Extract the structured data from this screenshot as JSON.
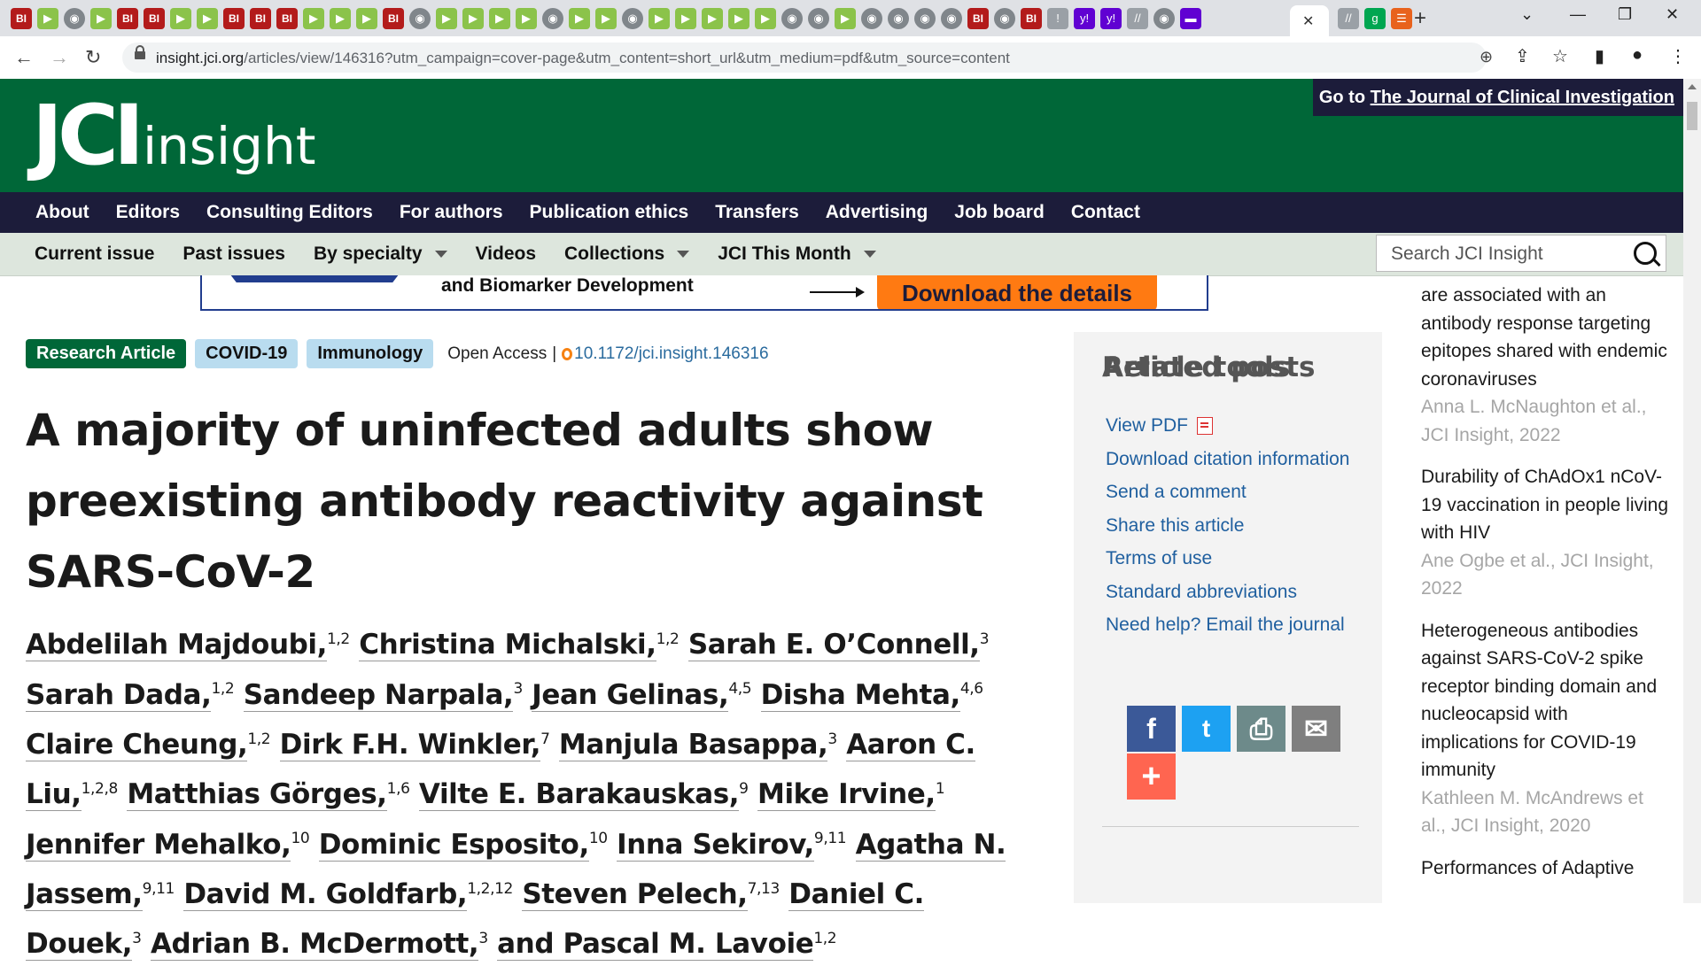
{
  "browser": {
    "url_host": "insight.jci.org",
    "url_rest": "/articles/view/146316?utm_campaign=cover-page&utm_content=short_url&utm_medium=pdf&utm_source=content",
    "tab_icons": [
      "BI",
      "▶",
      "◉",
      "▶",
      "BI",
      "BI",
      "▶",
      "▶",
      "BI",
      "BI",
      "BI",
      "▶",
      "▶",
      "▶",
      "BI",
      "◉",
      "▶",
      "▶",
      "▶",
      "▶",
      "◉",
      "▶",
      "▶",
      "◉",
      "▶",
      "▶",
      "▶",
      "▶",
      "▶",
      "◉",
      "◉",
      "▶",
      "◉",
      "◉",
      "◉",
      "◉",
      "BI",
      "◉",
      "BI",
      "!",
      "y!",
      "y!",
      "//",
      "◉",
      "▬"
    ],
    "active_tab_icons": [
      "//",
      "g",
      "☰"
    ],
    "close_tab": "✕",
    "new_tab": "+"
  },
  "header": {
    "logo_jci": "JCI",
    "logo_insight": "insight",
    "goto_prefix": "Go to",
    "goto_link": "The Journal of Clinical Investigation"
  },
  "main_nav": [
    "About",
    "Editors",
    "Consulting Editors",
    "For authors",
    "Publication ethics",
    "Transfers",
    "Advertising",
    "Job board",
    "Contact"
  ],
  "sub_nav": {
    "current_issue": "Current issue",
    "past_issues": "Past issues",
    "by_specialty": "By specialty",
    "videos": "Videos",
    "collections": "Collections",
    "jci_this_month": "JCI This Month",
    "search_placeholder": "Search JCI Insight"
  },
  "ad": {
    "text": "and Biomarker Development",
    "button": "Download the details"
  },
  "article": {
    "badges": [
      "Research Article",
      "COVID-19",
      "Immunology"
    ],
    "open_access": "Open Access",
    "separator": "|",
    "doi": "10.1172/jci.insight.146316",
    "title": "A majority of uninfected adults show preexisting antibody reactivity against SARS-CoV-2",
    "authors": [
      {
        "name": "Abdelilah Majdoubi,",
        "sup": "1,2"
      },
      {
        "name": "Christina Michalski,",
        "sup": "1,2"
      },
      {
        "name": "Sarah E. O’Connell,",
        "sup": "3"
      },
      {
        "name": "Sarah Dada,",
        "sup": "1,2"
      },
      {
        "name": "Sandeep Narpala,",
        "sup": "3"
      },
      {
        "name": "Jean Gelinas,",
        "sup": "4,5"
      },
      {
        "name": "Disha Mehta,",
        "sup": "4,6"
      },
      {
        "name": "Claire Cheung,",
        "sup": "1,2"
      },
      {
        "name": "Dirk F.H. Winkler,",
        "sup": "7"
      },
      {
        "name": "Manjula Basappa,",
        "sup": "3"
      },
      {
        "name": "Aaron C. Liu,",
        "sup": "1,2,8"
      },
      {
        "name": "Matthias Görges,",
        "sup": "1,6"
      },
      {
        "name": "Vilte E. Barakauskas,",
        "sup": "9"
      },
      {
        "name": "Mike Irvine,",
        "sup": "1"
      },
      {
        "name": "Jennifer Mehalko,",
        "sup": "10"
      },
      {
        "name": "Dominic Esposito,",
        "sup": "10"
      },
      {
        "name": "Inna Sekirov,",
        "sup": "9,11"
      },
      {
        "name": "Agatha N. Jassem,",
        "sup": "9,11"
      },
      {
        "name": "David M. Goldfarb,",
        "sup": "1,2,12"
      },
      {
        "name": "Steven Pelech,",
        "sup": "7,13"
      },
      {
        "name": "Daniel C. Douek,",
        "sup": "3"
      },
      {
        "name": "Adrian B. McDermott,",
        "sup": "3"
      },
      {
        "name": "and Pascal M. Lavoie",
        "sup": "1,2"
      }
    ]
  },
  "tools": {
    "heading": "Article tools",
    "links": [
      "View PDF",
      "Download citation information",
      "Send a comment",
      "Share this article",
      "Terms of use",
      "Standard abbreviations",
      "Need help? Email the journal"
    ],
    "share_icons": [
      "f",
      "t",
      "⎙",
      "✉",
      "+"
    ],
    "related_heading": "Related posts"
  },
  "related_articles": [
    {
      "title": "are associated with an antibody response targeting epitopes shared with endemic coronaviruses",
      "meta": "Anna L. McNaughton et al., JCI Insight, 2022"
    },
    {
      "title": "Durability of ChAdOx1 nCoV-19 vaccination in people living with HIV",
      "meta": "Ane Ogbe et al., JCI Insight, 2022"
    },
    {
      "title": "Heterogeneous antibodies against SARS-CoV-2 spike receptor binding domain and nucleocapsid with implications for COVID-19 immunity",
      "meta": "Kathleen M. McAndrews et al., JCI Insight, 2020"
    },
    {
      "title": "Performances of Adaptive",
      "meta": ""
    }
  ],
  "colors": {
    "header_green": "#006738",
    "nav_navy": "#1c1c3a",
    "subnav_bg": "#dde6dd",
    "link_blue": "#1f5f9f",
    "badge_blue": "#b9dcef"
  }
}
